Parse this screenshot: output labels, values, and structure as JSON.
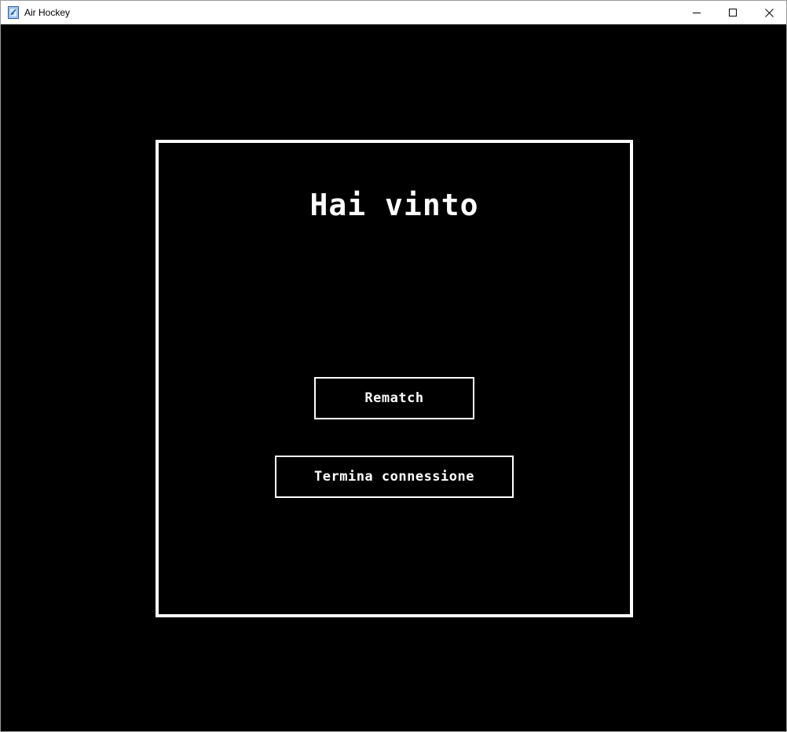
{
  "window": {
    "title": "Air Hockey",
    "icon": "app-icon",
    "controls": {
      "minimize_icon": "minimize-icon",
      "maximize_icon": "maximize-icon",
      "close_icon": "close-icon"
    }
  },
  "game": {
    "result_title": "Hai vinto",
    "buttons": {
      "rematch_label": "Rematch",
      "terminate_label": "Termina connessione"
    }
  },
  "colors": {
    "background": "#000000",
    "foreground": "#ffffff",
    "titlebar": "#ffffff"
  }
}
